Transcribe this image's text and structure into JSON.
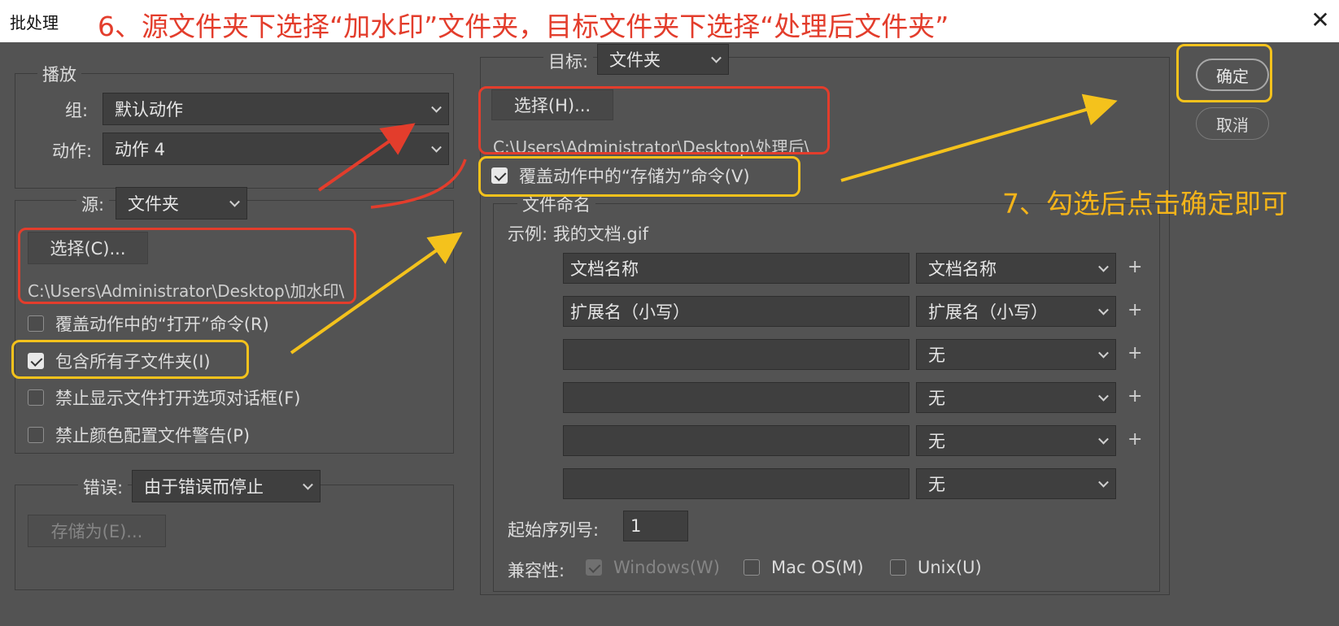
{
  "window": {
    "title": "批处理",
    "close_glyph": "✕"
  },
  "annotations": {
    "step6": "6、源文件夹下选择“加水印”文件夹，目标文件夹下选择“处理后文件夹”",
    "step7": "7、勾选后点击确定即可",
    "colors": {
      "red": "#e33d2c",
      "yellow": "#f4c21c"
    }
  },
  "play": {
    "legend": "播放",
    "group_label": "组:",
    "group_value": "默认动作",
    "action_label": "动作:",
    "action_value": "动作 4"
  },
  "source": {
    "label": "源:",
    "value": "文件夹",
    "choose_button": "选择(C)...",
    "path": "C:\\Users\\Administrator\\Desktop\\加水印\\",
    "checkboxes": [
      {
        "label": "覆盖动作中的“打开”命令(R)",
        "checked": false
      },
      {
        "label": "包含所有子文件夹(I)",
        "checked": true
      },
      {
        "label": "禁止显示文件打开选项对话框(F)",
        "checked": false
      },
      {
        "label": "禁止颜色配置文件警告(P)",
        "checked": false
      }
    ]
  },
  "error": {
    "label": "错误:",
    "value": "由于错误而停止",
    "save_as_button": "存储为(E)..."
  },
  "target": {
    "label": "目标:",
    "value": "文件夹",
    "choose_button": "选择(H)...",
    "path": "C:\\Users\\Administrator\\Desktop\\处理后\\",
    "override_save": {
      "label": "覆盖动作中的“存储为”命令(V)",
      "checked": true
    }
  },
  "naming": {
    "legend": "文件命名",
    "example": "示例: 我的文档.gif",
    "rows": [
      {
        "text": "文档名称",
        "select": "文档名称"
      },
      {
        "text": "扩展名（小写）",
        "select": "扩展名（小写）"
      },
      {
        "text": "",
        "select": "无"
      },
      {
        "text": "",
        "select": "无"
      },
      {
        "text": "",
        "select": "无"
      },
      {
        "text": "",
        "select": "无"
      }
    ],
    "plus_glyph": "+",
    "start_serial_label": "起始序列号:",
    "start_serial_value": "1",
    "compat_label": "兼容性:",
    "compat": [
      {
        "label": "Windows(W)",
        "checked": true,
        "disabled": true
      },
      {
        "label": "Mac OS(M)",
        "checked": false,
        "disabled": false
      },
      {
        "label": "Unix(U)",
        "checked": false,
        "disabled": false
      }
    ]
  },
  "buttons": {
    "ok": "确定",
    "cancel": "取消"
  }
}
